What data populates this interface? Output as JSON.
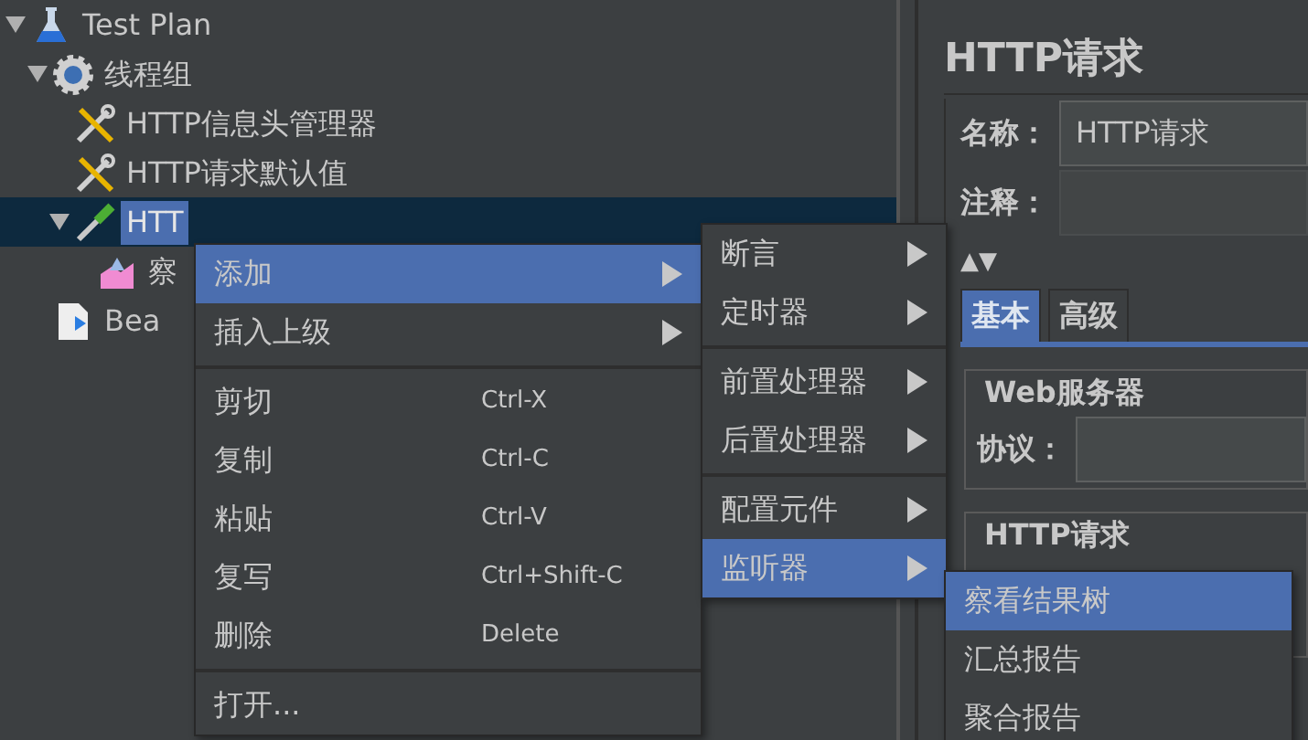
{
  "tree": [
    {
      "label": "Test Plan",
      "kind": "flask",
      "expanded": true,
      "selected": false,
      "children": [
        {
          "label": "线程组",
          "kind": "gear",
          "expanded": true,
          "selected": false,
          "children": [
            {
              "label": "HTTP信息头管理器",
              "kind": "tools",
              "selected": false
            },
            {
              "label": "HTTP请求默认值",
              "kind": "tools",
              "selected": false
            },
            {
              "label": "HTT",
              "kind": "pipette",
              "expanded": true,
              "selected": true,
              "children": [
                {
                  "label": "察",
                  "kind": "chart",
                  "selected": false
                }
              ]
            }
          ]
        },
        {
          "label": "Bea",
          "kind": "page",
          "selected": false
        }
      ]
    }
  ],
  "panel": {
    "title": "HTTP请求",
    "name_label": "名称：",
    "name_value": "HTTP请求",
    "comment_label": "注释：",
    "collapse_arrows": "▲▼",
    "tabs": [
      {
        "label": "基本",
        "selected": true
      },
      {
        "label": "高级",
        "selected": false
      }
    ],
    "groups": [
      {
        "title": "Web服务器",
        "field_label": "协议："
      },
      {
        "title": "HTTP请求"
      }
    ]
  },
  "context_menu": [
    {
      "kind": "submenu",
      "label": "添加",
      "selected": true
    },
    {
      "kind": "submenu",
      "label": "插入上级",
      "selected": false
    },
    {
      "kind": "separator"
    },
    {
      "kind": "item",
      "label": "剪切",
      "shortcut": "Ctrl-X",
      "selected": false
    },
    {
      "kind": "item",
      "label": "复制",
      "shortcut": "Ctrl-C",
      "selected": false
    },
    {
      "kind": "item",
      "label": "粘贴",
      "shortcut": "Ctrl-V",
      "selected": false
    },
    {
      "kind": "item",
      "label": "复写",
      "shortcut": "Ctrl+Shift-C",
      "selected": false
    },
    {
      "kind": "item",
      "label": "删除",
      "shortcut": "Delete",
      "selected": false
    },
    {
      "kind": "separator"
    },
    {
      "kind": "item",
      "label": "打开...",
      "selected": false
    }
  ],
  "add_submenu": [
    {
      "kind": "submenu",
      "label": "断言",
      "selected": false
    },
    {
      "kind": "submenu",
      "label": "定时器",
      "selected": false
    },
    {
      "kind": "separator"
    },
    {
      "kind": "submenu",
      "label": "前置处理器",
      "selected": false
    },
    {
      "kind": "submenu",
      "label": "后置处理器",
      "selected": false
    },
    {
      "kind": "separator"
    },
    {
      "kind": "submenu",
      "label": "配置元件",
      "selected": false
    },
    {
      "kind": "submenu",
      "label": "监听器",
      "selected": true
    }
  ],
  "listener_submenu": [
    {
      "kind": "item",
      "label": "察看结果树",
      "selected": true
    },
    {
      "kind": "item",
      "label": "汇总报告",
      "selected": false
    },
    {
      "kind": "item",
      "label": "聚合报告",
      "selected": false
    }
  ]
}
